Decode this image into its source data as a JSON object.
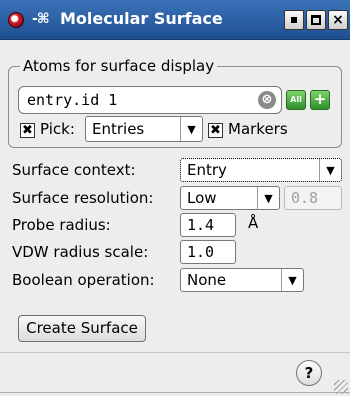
{
  "window": {
    "title": "Molecular Surface",
    "icons": {
      "app": "molecule-app-icon",
      "pin": "pin-icon"
    },
    "controls": {
      "minimize": "minimize-icon",
      "maximize": "maximize-icon",
      "close": "×"
    }
  },
  "atoms_group": {
    "title": "Atoms for surface display",
    "entry_value": "entry.id 1",
    "clear_icon": "⊗",
    "all_button": "All",
    "plus_button": "+",
    "pick": {
      "checked": true,
      "label": "Pick:",
      "value": "Entries"
    },
    "markers": {
      "checked": true,
      "label": "Markers"
    }
  },
  "form": {
    "surface_context": {
      "label": "Surface context:",
      "value": "Entry"
    },
    "surface_resolution": {
      "label": "Surface resolution:",
      "value": "Low",
      "numeric": "0.8"
    },
    "probe_radius": {
      "label": "Probe radius:",
      "value": "1.4",
      "unit": "Å"
    },
    "vdw_radius_scale": {
      "label": "VDW radius scale:",
      "value": "1.0"
    },
    "boolean_operation": {
      "label": "Boolean operation:",
      "value": "None"
    }
  },
  "actions": {
    "create_surface": "Create Surface",
    "help": "?"
  },
  "colors": {
    "titlebar": "#2b5fa8",
    "accent_green": "#3fa23a",
    "background": "#ededed"
  }
}
